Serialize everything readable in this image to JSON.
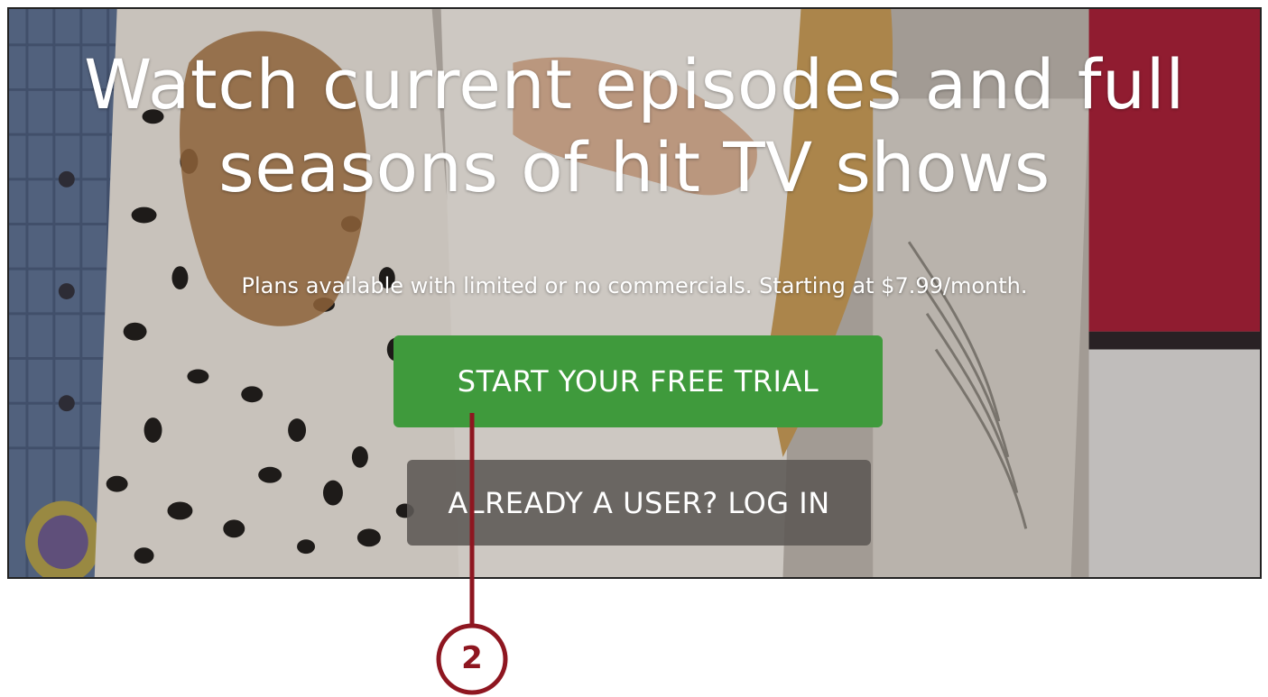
{
  "hero": {
    "headline_line1": "Watch current episodes and full",
    "headline_line2": "seasons of hit TV shows",
    "subheadline": "Plans available with limited or no commercials. Starting at $7.99/month."
  },
  "buttons": {
    "start_trial_label": "START YOUR FREE TRIAL",
    "login_label": "ALREADY A USER? LOG IN"
  },
  "callout": {
    "number": "2",
    "color": "#8e1620"
  },
  "colors": {
    "trial_button": "#3f9a3c",
    "login_button": "#5c5854"
  }
}
